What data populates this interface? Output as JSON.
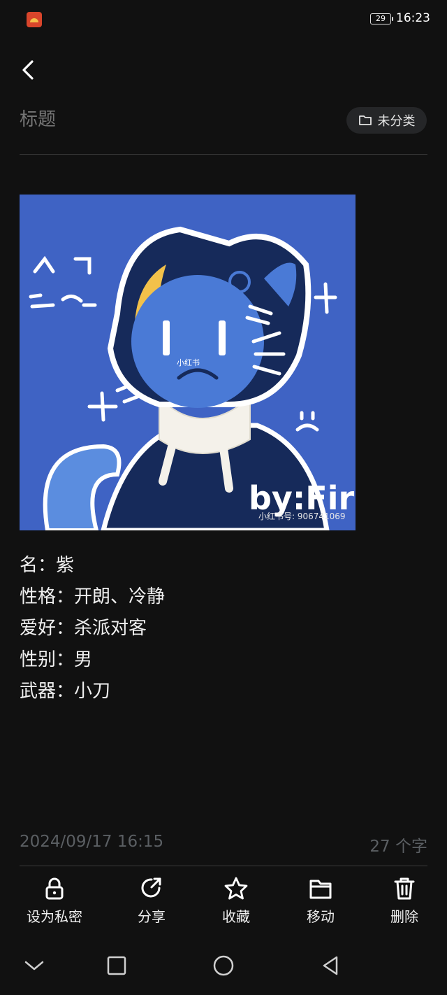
{
  "status_bar": {
    "battery": "29",
    "time": "16:23"
  },
  "header": {
    "title_placeholder": "标题",
    "category": "未分类"
  },
  "note": {
    "image_watermark_small": "小红书",
    "image_watermark_id": "小红书号: 906741069",
    "image_signature": "by:Fire",
    "lines": [
      "名：紫",
      "性格：开朗、冷静",
      "爱好：杀派对客",
      "性别：男",
      "武器：小刀"
    ]
  },
  "meta": {
    "date": "2024/09/17 16:15",
    "char_count": "27 个字"
  },
  "toolbar": {
    "private_label": "设为私密",
    "share_label": "分享",
    "favorite_label": "收藏",
    "move_label": "移动",
    "delete_label": "删除"
  }
}
